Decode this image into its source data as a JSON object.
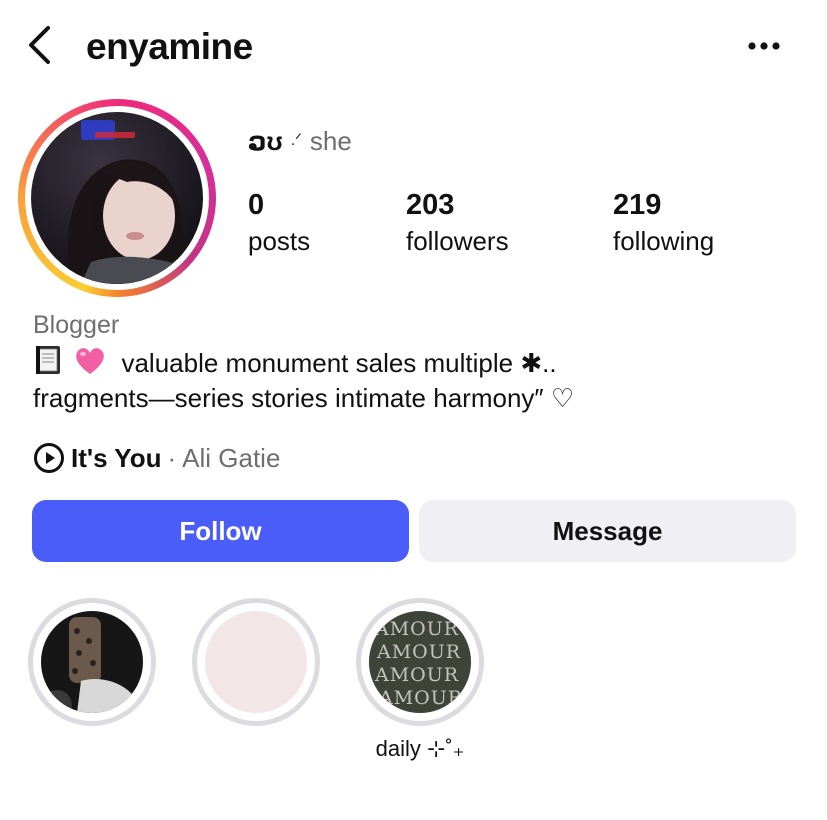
{
  "header": {
    "username": "enyamine"
  },
  "profile": {
    "pronoun_glyph": "ວʊ",
    "pronoun_spark": ".ᐟ",
    "pronouns": "she",
    "stats": [
      {
        "value": "0",
        "label": "posts"
      },
      {
        "value": "203",
        "label": "followers"
      },
      {
        "value": "219",
        "label": "following"
      }
    ],
    "category": "Blogger",
    "bio_line1": "valuable monument sales multiple ✱..",
    "bio_line2": "fragments—series stories intimate harmony″ ♡",
    "music": {
      "song": "It's You",
      "separator": "·",
      "artist": "Ali Gatie"
    }
  },
  "actions": {
    "follow_label": "Follow",
    "message_label": "Message"
  },
  "highlights": [
    {
      "label": ""
    },
    {
      "label": ""
    },
    {
      "label": "daily ⊹˚₊"
    }
  ],
  "colors": {
    "follow_button": "#4a5df9",
    "message_button": "#efeff4",
    "secondary_text": "#6e6e73",
    "highlight_ring": "#dbdbe0"
  },
  "icons": {
    "back": "chevron-left-icon",
    "more": "more-horizontal-icon",
    "music": "play-circle-icon"
  }
}
